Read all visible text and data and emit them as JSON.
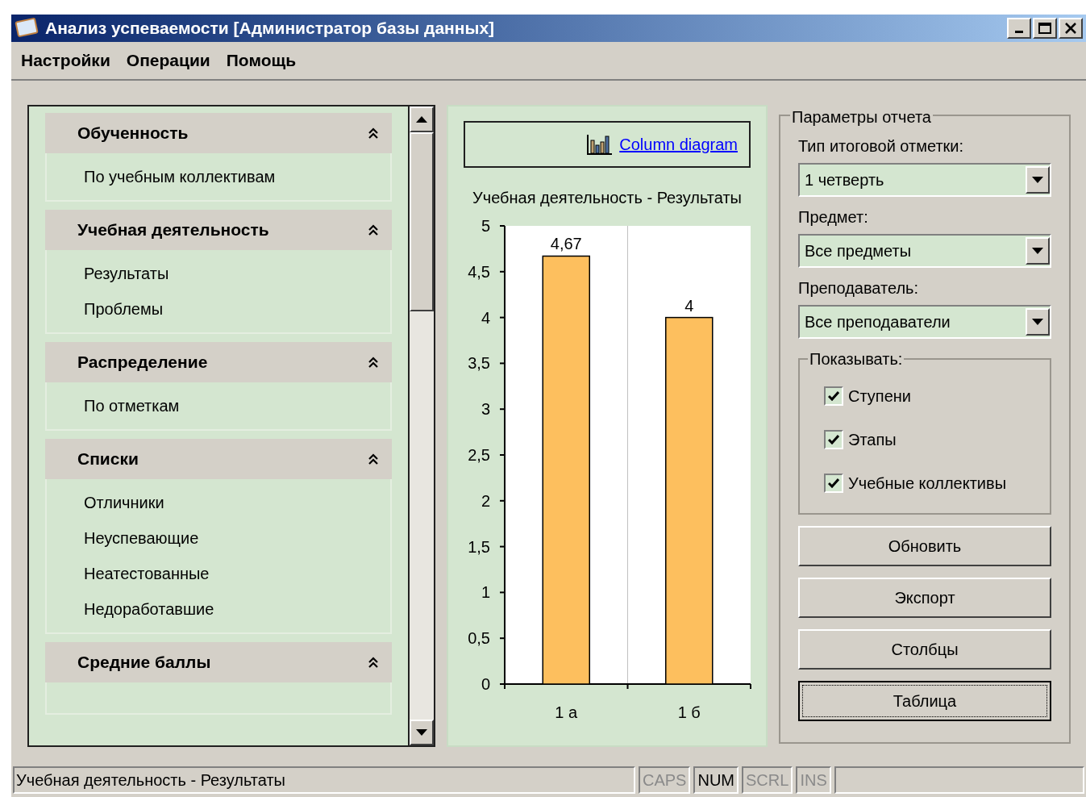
{
  "window": {
    "title": "Анализ успеваемости [Администратор базы данных]"
  },
  "menu": [
    "Настройки",
    "Операции",
    "Помощь"
  ],
  "nav_groups": [
    {
      "title": "Обученность",
      "expanded": true,
      "items": [
        "По учебным коллективам"
      ]
    },
    {
      "title": "Учебная деятельность",
      "expanded": true,
      "items": [
        "Результаты",
        "Проблемы"
      ]
    },
    {
      "title": "Распределение",
      "expanded": true,
      "items": [
        "По отметкам"
      ]
    },
    {
      "title": "Списки",
      "expanded": true,
      "items": [
        "Отличники",
        "Неуспевающие",
        "Неатестованные",
        "Недоработавшие"
      ]
    },
    {
      "title": "Средние баллы",
      "expanded": true
    }
  ],
  "chart_panel": {
    "link": "Column diagram",
    "title": "Учебная деятельность - Результаты",
    "chart_data": {
      "type": "bar",
      "categories": [
        "1 а",
        "1 б"
      ],
      "values": [
        4.67,
        4
      ],
      "ylim": [
        0,
        5
      ],
      "yticks": [
        {
          "value": 0,
          "label": "0"
        },
        {
          "value": 0.5,
          "label": "0,5"
        },
        {
          "value": 1,
          "label": "1"
        },
        {
          "value": 1.5,
          "label": "1,5"
        },
        {
          "value": 2,
          "label": "2"
        },
        {
          "value": 2.5,
          "label": "2,5"
        },
        {
          "value": 3,
          "label": "3"
        },
        {
          "value": 3.5,
          "label": "3,5"
        },
        {
          "value": 4,
          "label": "4"
        },
        {
          "value": 4.5,
          "label": "4,5"
        },
        {
          "value": 5,
          "label": "5"
        }
      ],
      "value_labels": [
        "4,67",
        "4"
      ]
    }
  },
  "report_params": {
    "legend": "Параметры отчета",
    "fields": [
      {
        "label": "Тип итоговой отметки:",
        "value": "1 четверть"
      },
      {
        "label": "Предмет:",
        "value": "Все предметы"
      },
      {
        "label": "Преподаватель:",
        "value": "Все преподаватели"
      }
    ],
    "show": {
      "legend": "Показывать:",
      "options": [
        {
          "label": "Ступени",
          "checked": true
        },
        {
          "label": "Этапы",
          "checked": true
        },
        {
          "label": "Учебные коллективы",
          "checked": true
        }
      ]
    },
    "buttons": [
      {
        "label": "Обновить",
        "focused": false
      },
      {
        "label": "Экспорт",
        "focused": false
      },
      {
        "label": "Столбцы",
        "focused": false
      },
      {
        "label": "Таблица",
        "focused": true
      }
    ]
  },
  "status_bar": {
    "text": "Учебная деятельность - Результаты",
    "indicators": [
      {
        "label": "CAPS",
        "on": false
      },
      {
        "label": "NUM",
        "on": true
      },
      {
        "label": "SCRL",
        "on": false
      },
      {
        "label": "INS",
        "on": false
      }
    ]
  }
}
